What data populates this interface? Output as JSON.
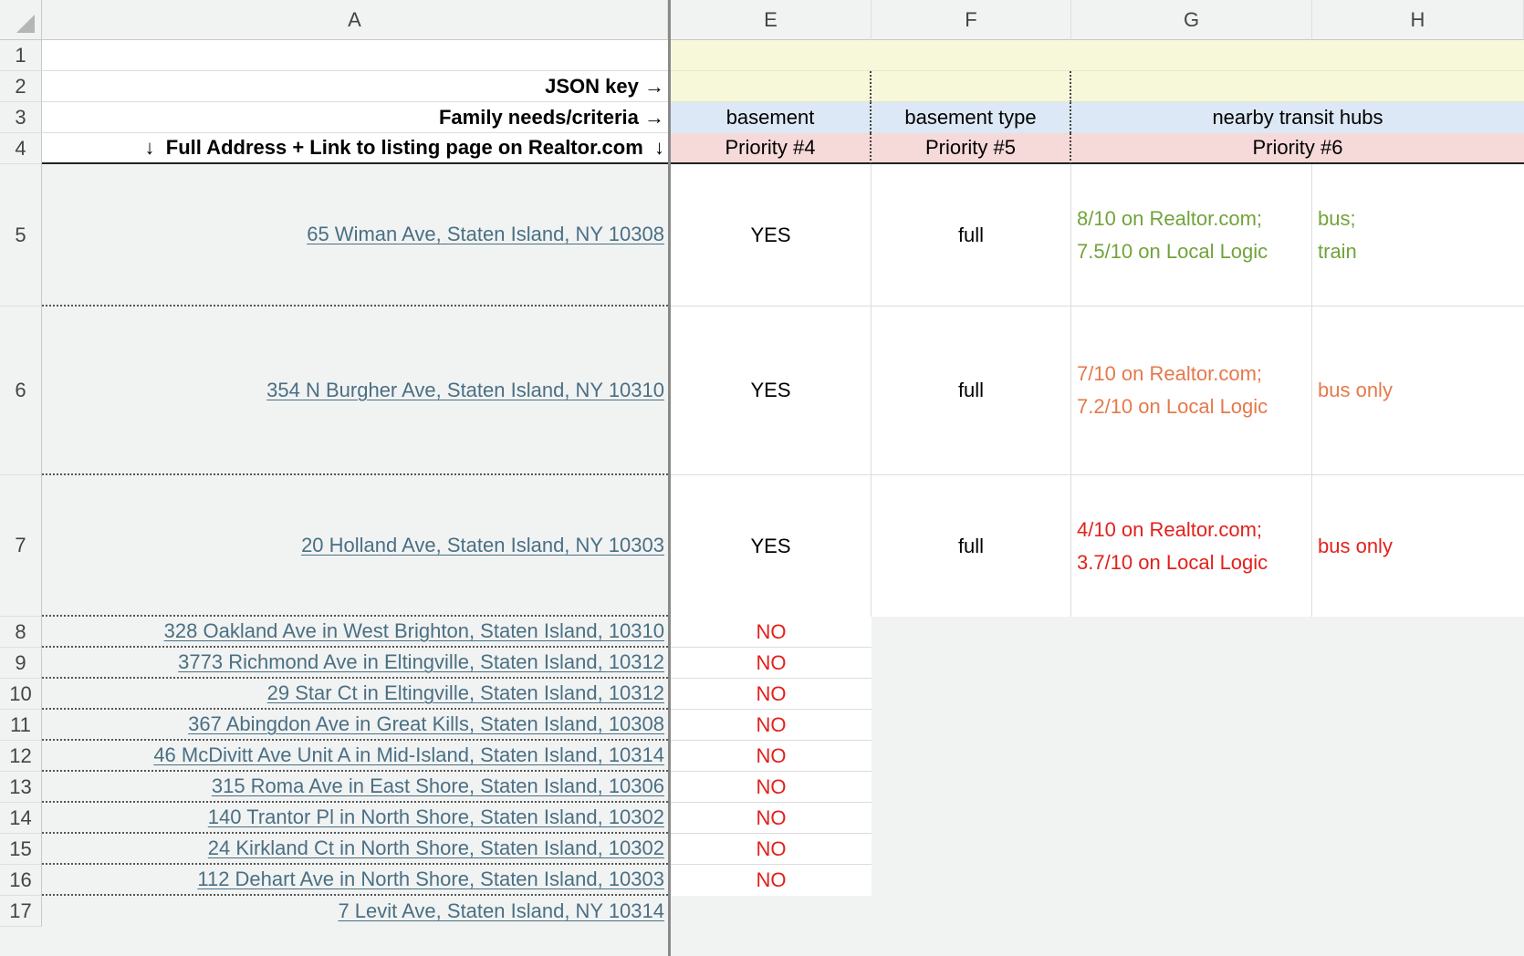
{
  "columns": [
    "A",
    "E",
    "F",
    "G",
    "H"
  ],
  "rows": [
    "1",
    "2",
    "3",
    "4",
    "5",
    "6",
    "7",
    "8",
    "9",
    "10",
    "11",
    "12",
    "13",
    "14",
    "15",
    "16",
    "17"
  ],
  "labels": {
    "json_key": "JSON key",
    "family_needs": "Family needs/criteria",
    "full_address": "Full Address + Link to listing page on Realtor.com",
    "arrow_right": "→",
    "arrow_down": "↓"
  },
  "criteria": {
    "basement": "basement",
    "basement_type": "basement type",
    "transit": "nearby transit hubs"
  },
  "priorities": {
    "p4": "Priority #4",
    "p5": "Priority #5",
    "p6": "Priority #6"
  },
  "listings": [
    {
      "address": "65 Wiman Ave, Staten Island, NY 10308",
      "basement": "YES",
      "type": "full",
      "score1": "8/10 on Realtor.com;",
      "score2": "7.5/10 on Local Logic",
      "hub1": "bus;",
      "hub2": "train"
    },
    {
      "address": "354 N Burgher Ave, Staten Island, NY 10310",
      "basement": "YES",
      "type": "full",
      "score1": "7/10 on Realtor.com;",
      "score2": "7.2/10 on Local Logic",
      "hub1": "bus only"
    },
    {
      "address": "20 Holland Ave, Staten Island, NY 10303",
      "basement": "YES",
      "type": "full",
      "score1": "4/10 on Realtor.com;",
      "score2": "3.7/10 on Local Logic",
      "hub1": "bus only"
    }
  ],
  "rejected": [
    {
      "address": "328 Oakland Ave in West Brighton, Staten Island, 10310",
      "basement": "NO"
    },
    {
      "address": "3773 Richmond Ave in Eltingville, Staten Island, 10312",
      "basement": "NO"
    },
    {
      "address": "29 Star Ct in Eltingville, Staten Island, 10312",
      "basement": "NO"
    },
    {
      "address": "367 Abingdon Ave in Great Kills, Staten Island, 10308",
      "basement": "NO"
    },
    {
      "address": "46 McDivitt Ave Unit A in Mid-Island, Staten Island, 10314",
      "basement": "NO"
    },
    {
      "address": "315 Roma Ave in East Shore, Staten Island, 10306",
      "basement": "NO"
    },
    {
      "address": "140 Trantor Pl in North Shore, Staten Island, 10302",
      "basement": "NO"
    },
    {
      "address": "24 Kirkland Ct in North Shore, Staten Island, 10302",
      "basement": "NO"
    },
    {
      "address": "112 Dehart Ave in North Shore, Staten Island, 10303",
      "basement": "NO"
    },
    {
      "address": "7 Levit Ave, Staten Island, NY 10314"
    }
  ],
  "colors": {
    "yellow": "#f7f7da",
    "blue": "#dce8f5",
    "pink": "#f6d9d9",
    "green": "#72a33a",
    "orange": "#e5794b",
    "red": "#e3201b",
    "link": "#4a6f84"
  }
}
